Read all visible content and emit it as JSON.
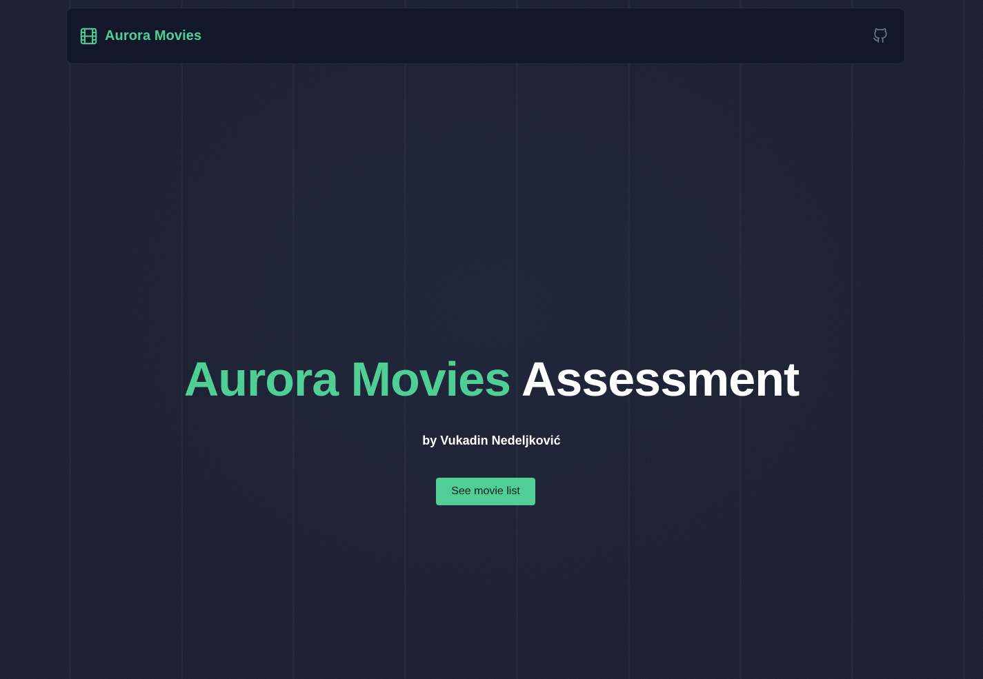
{
  "colors": {
    "background": "#161b2d",
    "navbar_bg": "#121829",
    "accent": "#4fcf95",
    "text": "#ffffff",
    "icon_muted": "#6b7280"
  },
  "navbar": {
    "brand_icon": "film-icon",
    "brand_name": "Aurora Movies",
    "github_icon": "github-icon"
  },
  "hero": {
    "title_accent": "Aurora Movies",
    "title_main": "Assessment",
    "subtitle": "by Vukadin Nedeljković",
    "cta_label": "See movie list"
  }
}
